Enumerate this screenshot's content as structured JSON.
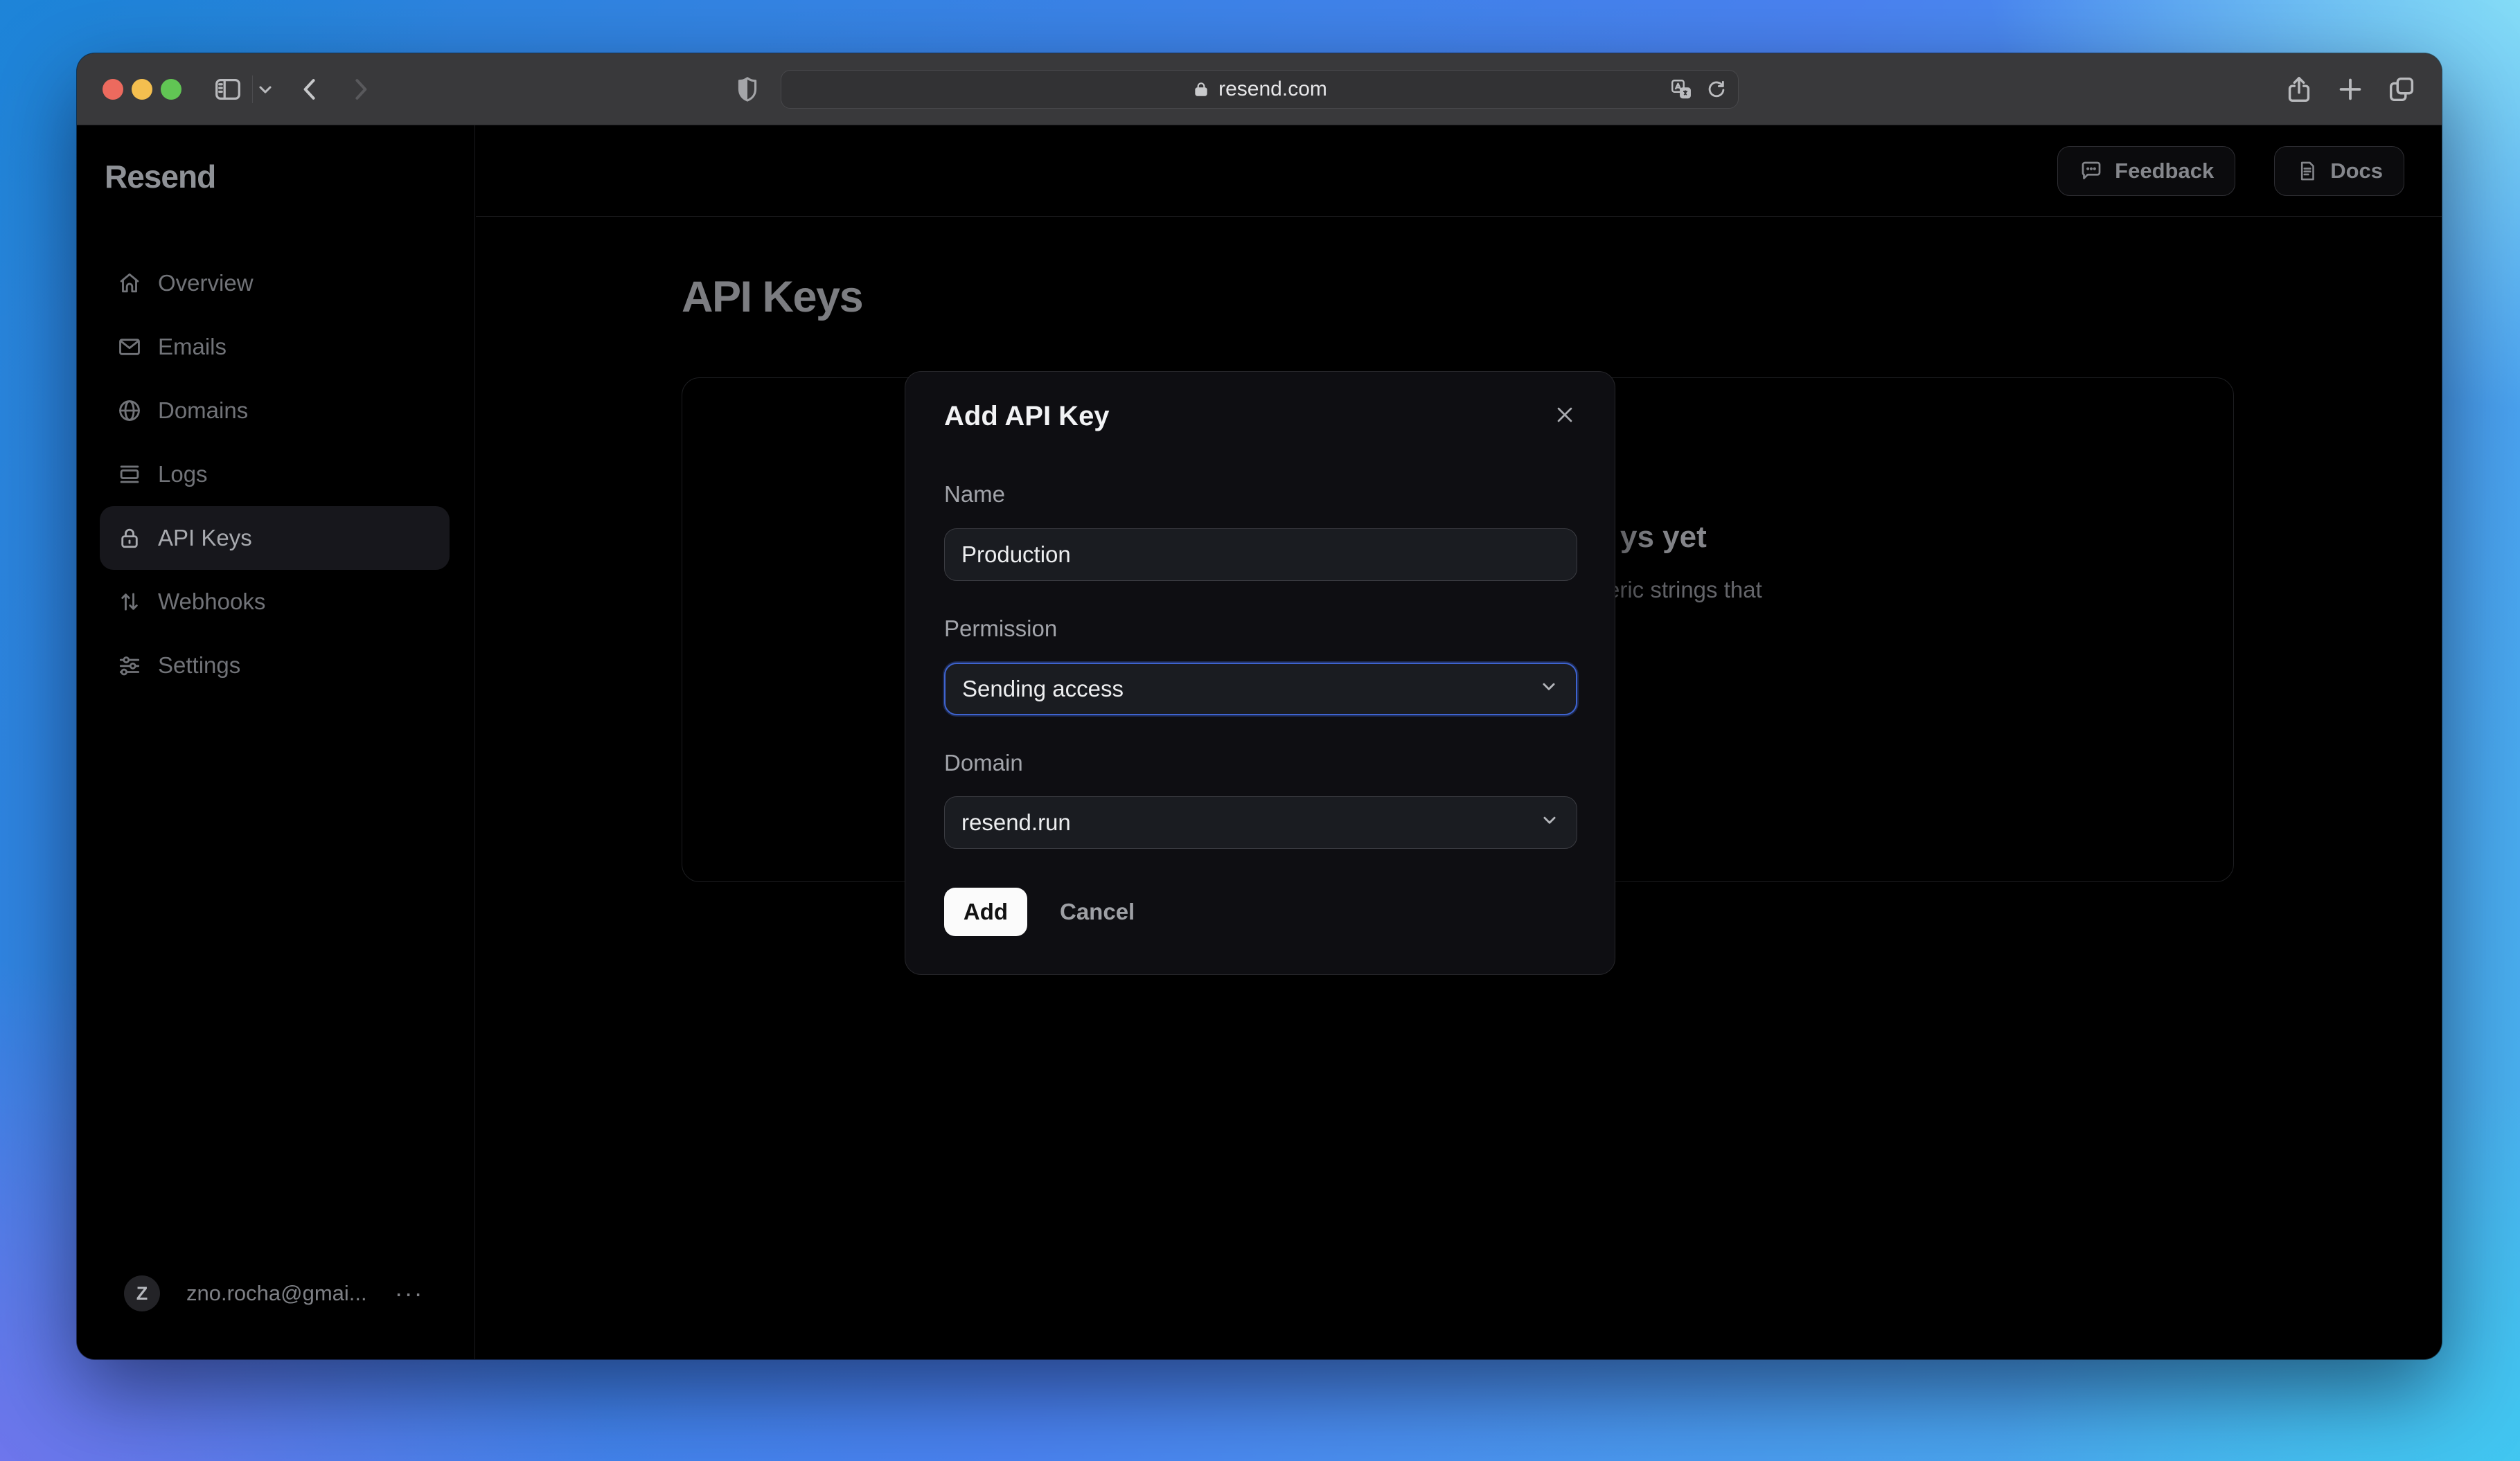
{
  "browser": {
    "url": "resend.com",
    "icons": [
      "sidebar-toggle",
      "chevron-down",
      "back",
      "forward",
      "shield",
      "lock",
      "translate",
      "reload",
      "share",
      "new-tab",
      "tabs-overview"
    ]
  },
  "sidebar": {
    "logo": "Resend",
    "items": [
      {
        "label": "Overview",
        "icon": "home-icon",
        "active": false
      },
      {
        "label": "Emails",
        "icon": "envelope-icon",
        "active": false
      },
      {
        "label": "Domains",
        "icon": "globe-icon",
        "active": false
      },
      {
        "label": "Logs",
        "icon": "logs-icon",
        "active": false
      },
      {
        "label": "API Keys",
        "icon": "lock-icon",
        "active": true
      },
      {
        "label": "Webhooks",
        "icon": "arrows-up-down-icon",
        "active": false
      },
      {
        "label": "Settings",
        "icon": "sliders-icon",
        "active": false
      }
    ],
    "user": {
      "avatar_initial": "Z",
      "email": "zno.rocha@gmai...",
      "menu": "···"
    }
  },
  "header": {
    "feedback_label": "Feedback",
    "docs_label": "Docs"
  },
  "page": {
    "title": "API Keys",
    "empty_state_visible_fragments": {
      "heading": "ys yet",
      "description": "eric strings that"
    }
  },
  "modal": {
    "title": "Add API Key",
    "name_label": "Name",
    "name_value": "Production",
    "permission_label": "Permission",
    "permission_value": "Sending access",
    "domain_label": "Domain",
    "domain_value": "resend.run",
    "add_label": "Add",
    "cancel_label": "Cancel"
  },
  "colors": {
    "gradient_blue": "#2485da",
    "gradient_cyan": "#40c9f1",
    "gradient_purple": "#7d72ee",
    "toolbar": "#39393b",
    "page_bg": "#000000",
    "modal_bg": "#0e0e12",
    "input_bg": "#1a1c21",
    "input_border": "#3b3c42",
    "focus_ring": "#3e63cf",
    "add_button_bg": "#fbfbfb",
    "traffic_red": "#ec6a5e",
    "traffic_yellow": "#f4bf4f",
    "traffic_green": "#61c554"
  }
}
